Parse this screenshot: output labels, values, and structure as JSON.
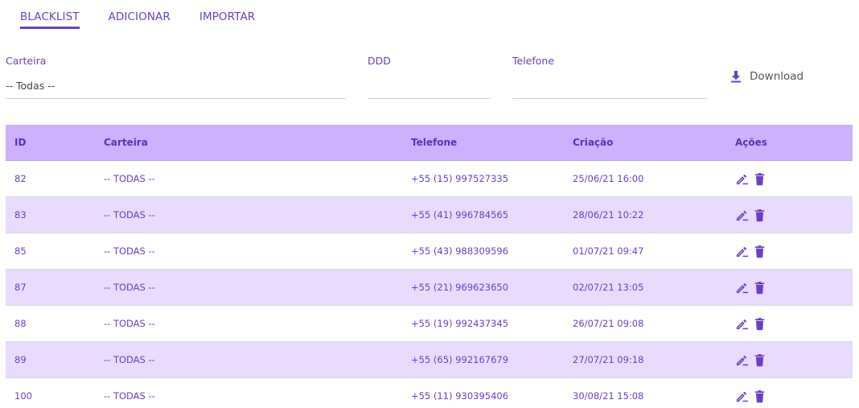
{
  "tabs": [
    {
      "label": "BLACKLIST",
      "active": true
    },
    {
      "label": "ADICIONAR",
      "active": false
    },
    {
      "label": "IMPORTAR",
      "active": false
    }
  ],
  "filters": {
    "carteira": {
      "label": "Carteira",
      "value": "-- Todas --"
    },
    "ddd": {
      "label": "DDD",
      "value": ""
    },
    "telefone": {
      "label": "Telefone",
      "value": ""
    }
  },
  "download": {
    "label": "Download",
    "icon": "download-icon"
  },
  "table": {
    "headers": {
      "id": "ID",
      "carteira": "Carteira",
      "telefone": "Telefone",
      "criacao": "Criação",
      "acoes": "Ações"
    },
    "rows": [
      {
        "id": "82",
        "carteira": "-- TODAS --",
        "telefone": "+55 (15) 997527335",
        "criacao": "25/06/21 16:00"
      },
      {
        "id": "83",
        "carteira": "-- TODAS --",
        "telefone": "+55 (41) 996784565",
        "criacao": "28/06/21 10:22"
      },
      {
        "id": "85",
        "carteira": "-- TODAS --",
        "telefone": "+55 (43) 988309596",
        "criacao": "01/07/21 09:47"
      },
      {
        "id": "87",
        "carteira": "-- TODAS --",
        "telefone": "+55 (21) 969623650",
        "criacao": "02/07/21 13:05"
      },
      {
        "id": "88",
        "carteira": "-- TODAS --",
        "telefone": "+55 (19) 992437345",
        "criacao": "26/07/21 09:08"
      },
      {
        "id": "89",
        "carteira": "-- TODAS --",
        "telefone": "+55 (65) 992167679",
        "criacao": "27/07/21 09:18"
      },
      {
        "id": "100",
        "carteira": "-- TODAS --",
        "telefone": "+55 (11) 930395406",
        "criacao": "30/08/21 15:08"
      }
    ]
  },
  "icons": {
    "edit": "edit-icon",
    "delete": "trash-icon"
  },
  "colors": {
    "accent": "#6b3fc7",
    "header_bg": "#cdb1fd",
    "row_alt_bg": "#e8dbfd"
  }
}
